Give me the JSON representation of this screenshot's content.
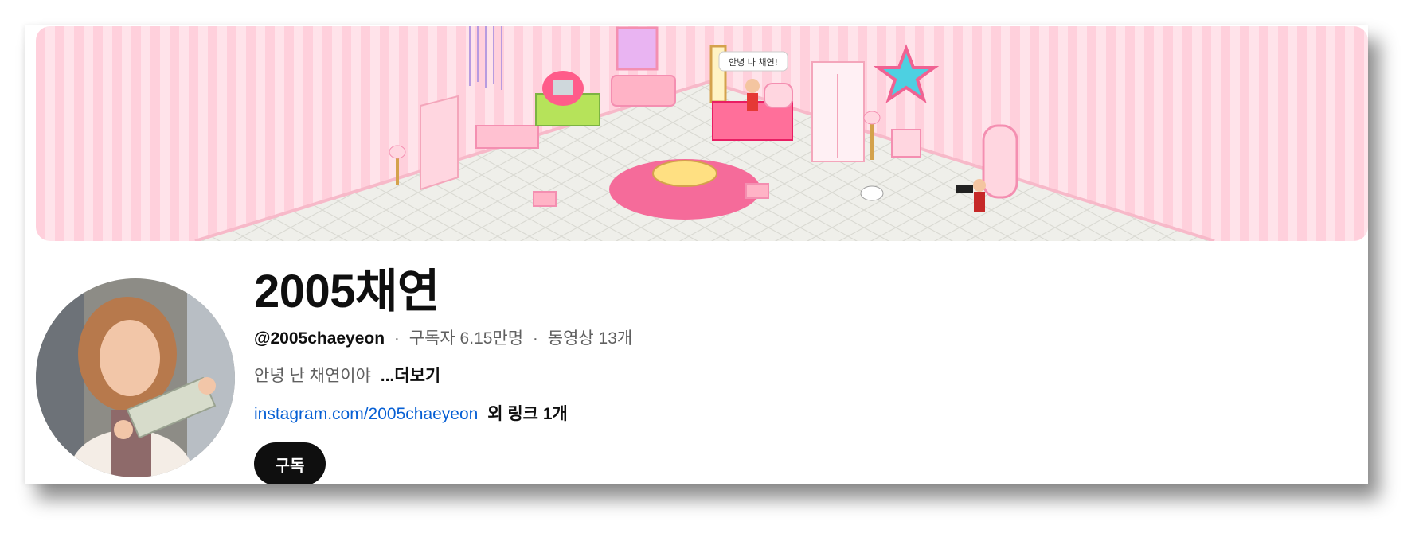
{
  "banner": {
    "speech_bubble": "안녕 나 채연!",
    "description": "pixel-art-pink-bedroom"
  },
  "channel": {
    "title": "2005채연",
    "handle": "@2005chaeyeon",
    "separator": "·",
    "subscribers": "구독자 6.15만명",
    "videos": "동영상 13개",
    "description": "안녕 난 채연이야",
    "more_label": "...더보기",
    "link_text": "instagram.com/2005chaeyeon",
    "extra_links": "외 링크 1개",
    "subscribe_label": "구독"
  },
  "colors": {
    "banner_stripe_light": "#ffe3ea",
    "banner_stripe_dark": "#ffd0dc",
    "floor": "#efefea",
    "rug": "#f56b9a",
    "link_blue": "#065fd4",
    "button_black": "#0f0f0f"
  },
  "icons": {
    "avatar": "avatar-photo"
  }
}
